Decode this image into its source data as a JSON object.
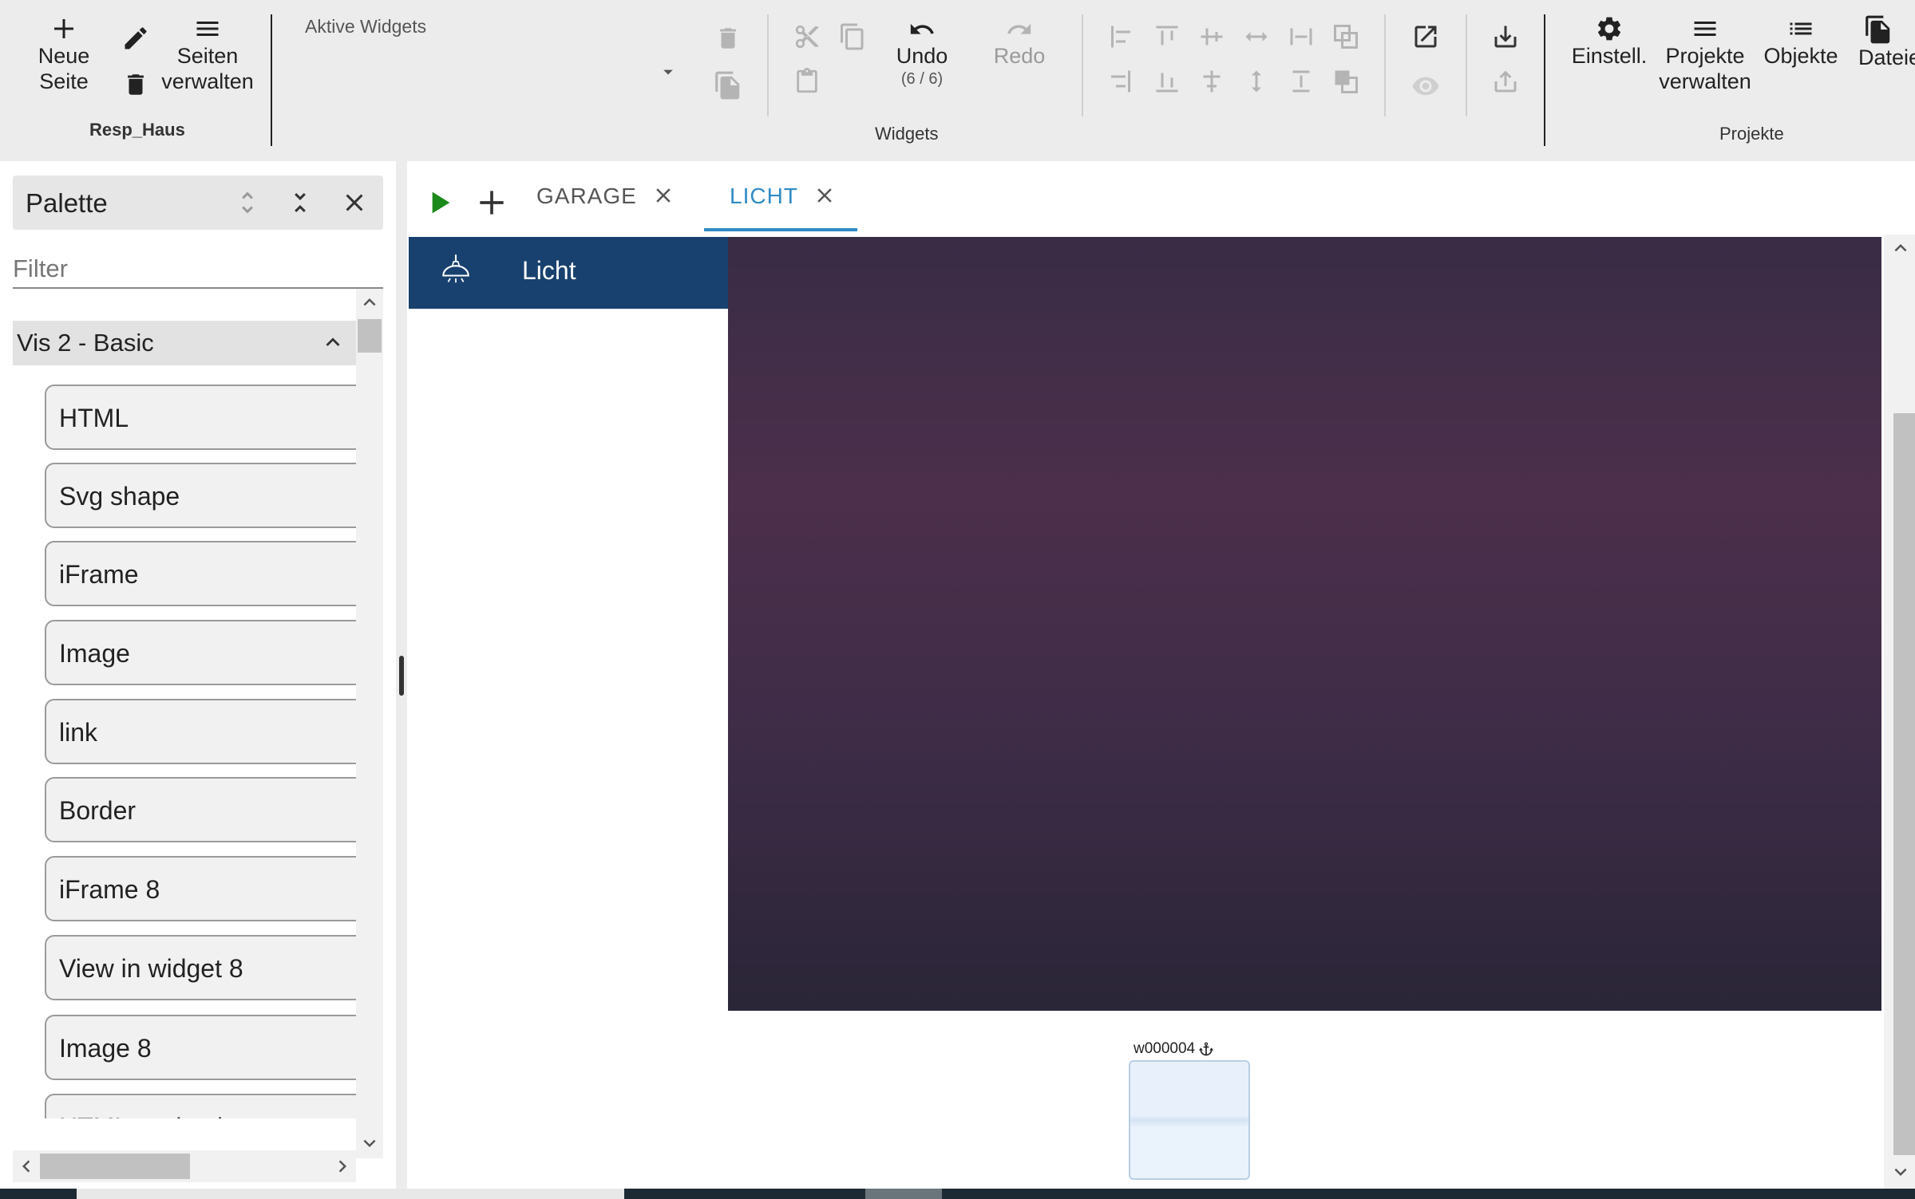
{
  "toolbar": {
    "new_page": {
      "line1": "Neue",
      "line2": "Seite"
    },
    "manage_pages": {
      "line1": "Seiten",
      "line2": "verwalten"
    },
    "project_name": "Resp_Haus",
    "active_widgets_label": "Aktive Widgets",
    "undo": {
      "label": "Undo",
      "count": "(6 / 6)"
    },
    "redo": {
      "label": "Redo"
    },
    "widgets_group_label": "Widgets",
    "settings_label": "Einstell.",
    "manage_projects": {
      "line1": "Projekte",
      "line2": "verwalten"
    },
    "objects_label": "Objekte",
    "files_label": "Dateie",
    "projects_group_label": "Projekte"
  },
  "palette": {
    "title": "Palette",
    "filter_placeholder": "Filter",
    "category": "Vis 2 - Basic",
    "items": [
      "HTML",
      "Svg shape",
      "iFrame",
      "Image",
      "link",
      "Border",
      "iFrame 8",
      "View in widget 8",
      "Image 8",
      "HTML navigation"
    ]
  },
  "tabs": [
    {
      "label": "GARAGE",
      "active": false
    },
    {
      "label": "LICHT",
      "active": true
    }
  ],
  "canvas": {
    "nav_title": "Licht",
    "widget_id": "w000004"
  },
  "colors": {
    "accent": "#2f8ac4",
    "nav_bar": "#18416f",
    "run_green": "#1b8a1b",
    "view_top": "#392c45",
    "view_mid": "#4c2f4b",
    "view_bottom": "#2a2537"
  }
}
